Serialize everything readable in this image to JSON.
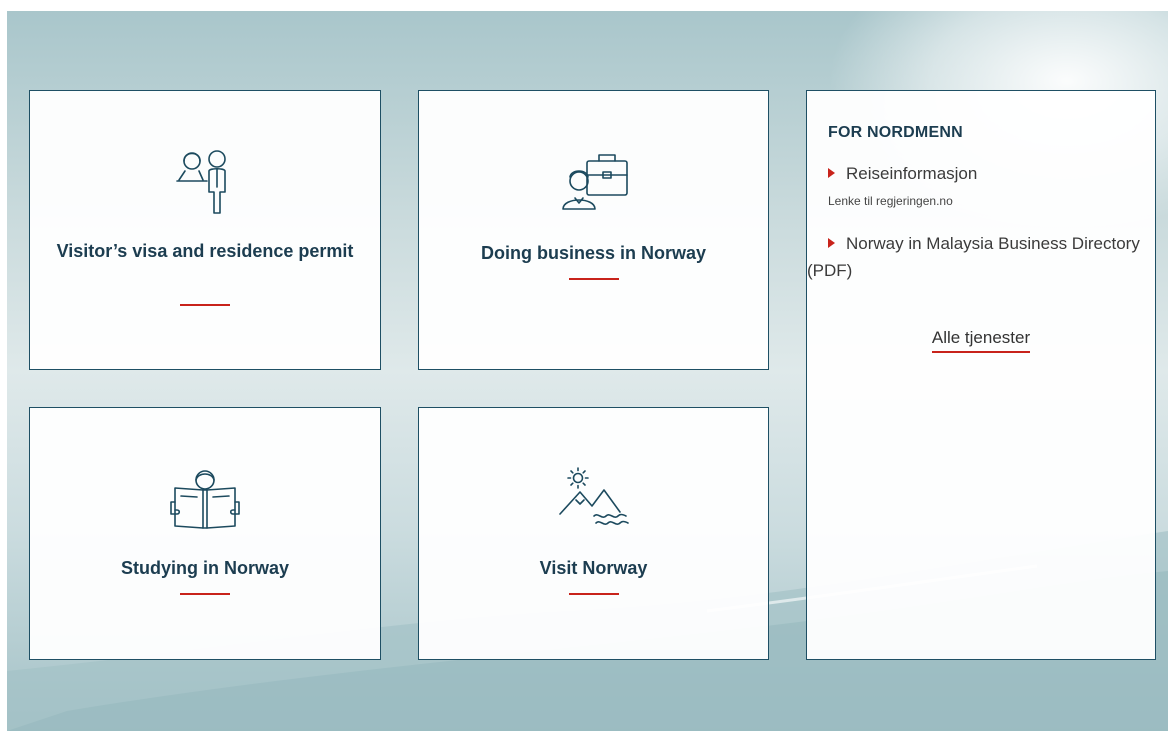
{
  "tiles": [
    {
      "title": "Visitor’s visa and residence permit",
      "icon": "visa-people-icon"
    },
    {
      "title": "Doing business in Norway",
      "icon": "business-briefcase-icon"
    },
    {
      "title": "Studying in Norway",
      "icon": "student-reading-icon"
    },
    {
      "title": "Visit Norway",
      "icon": "mountain-sun-icon"
    }
  ],
  "side_panel": {
    "heading": "FOR NORDMENN",
    "links": [
      {
        "label": "Reiseinformasjon",
        "sub": "Lenke til regjeringen.no"
      },
      {
        "label": "Norway in Malaysia Business Directory (PDF)"
      }
    ],
    "all_services": "Alle tjenester"
  },
  "colors": {
    "accent_red": "#c8231b",
    "border_navy": "#1e4f64",
    "title_text": "#1c3d50"
  }
}
